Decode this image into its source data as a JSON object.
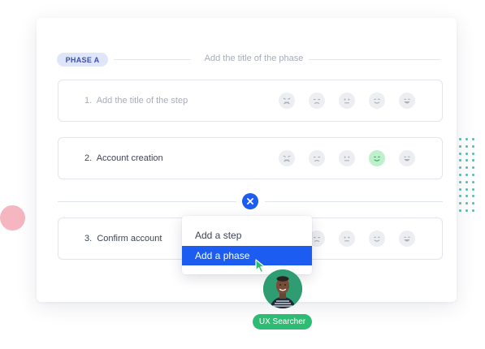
{
  "phase": {
    "badge": "PHASE A",
    "title_placeholder": "Add the title of the phase"
  },
  "steps": [
    {
      "number": "1.",
      "label": "Add the title of the step",
      "is_placeholder": true,
      "selected_face": null
    },
    {
      "number": "2.",
      "label": "Account creation",
      "is_placeholder": false,
      "selected_face": "happy"
    },
    {
      "number": "3.",
      "label": "Confirm account",
      "is_placeholder": false,
      "selected_face": null
    }
  ],
  "faces": [
    "very-sad",
    "sad",
    "neutral",
    "happy",
    "very-happy"
  ],
  "menu": {
    "items": [
      {
        "label": "Add a step",
        "selected": false
      },
      {
        "label": "Add a phase",
        "selected": true
      }
    ]
  },
  "user": {
    "name": "UX Searcher"
  },
  "colors": {
    "accent": "#1c5cf0",
    "badge_bg": "#dfe6f9",
    "badge_text": "#3a4fb0",
    "face_active": "#bdf0cb",
    "user_badge": "#2ebc74",
    "pink_decor": "#f6b6c1",
    "teal_decor": "#49c3b4"
  }
}
